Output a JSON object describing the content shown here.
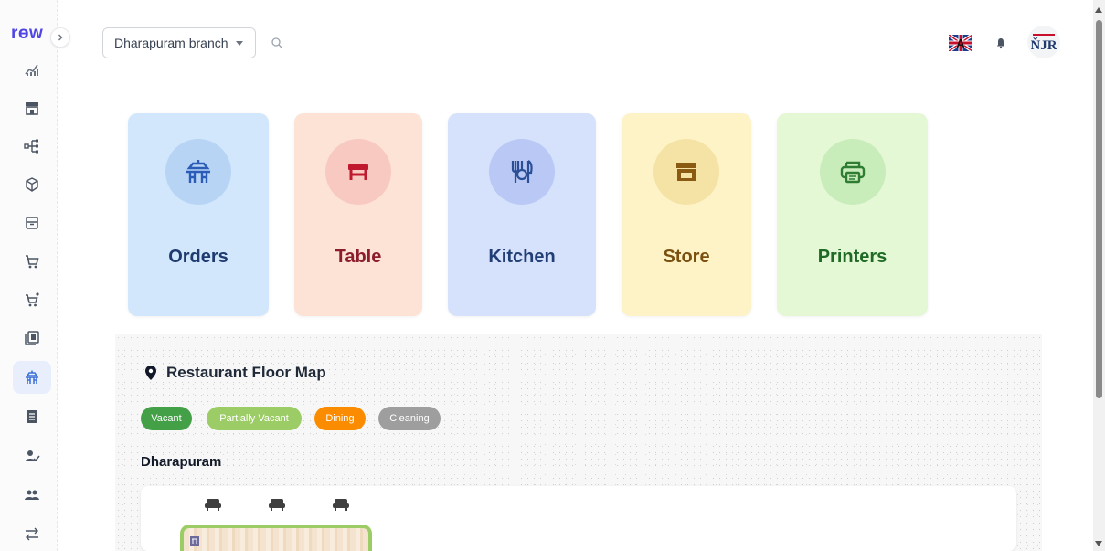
{
  "app": {
    "logo_text": "rөw"
  },
  "header": {
    "branch_selector": {
      "value": "Dharapuram branch"
    },
    "avatar_text": "ŇJR"
  },
  "sidebar": {
    "items": [
      {
        "icon": "analytics-icon",
        "active": false
      },
      {
        "icon": "store-icon",
        "active": false
      },
      {
        "icon": "hierarchy-icon",
        "active": false
      },
      {
        "icon": "cube-icon",
        "active": false
      },
      {
        "icon": "archive-box-icon",
        "active": false
      },
      {
        "icon": "cart-icon",
        "active": false
      },
      {
        "icon": "cart-plus-icon",
        "active": false
      },
      {
        "icon": "layers-icon",
        "active": false
      },
      {
        "icon": "dining-table-icon",
        "active": true
      },
      {
        "icon": "list-icon",
        "active": false
      },
      {
        "icon": "user-check-icon",
        "active": false
      },
      {
        "icon": "users-icon",
        "active": false
      },
      {
        "icon": "transfer-icon",
        "active": false
      }
    ]
  },
  "modules": [
    {
      "label": "Orders",
      "bg": "#d3e7fc",
      "circle": "#b8d4f5",
      "color": "#1e3a6e",
      "icon": "dining-table-icon"
    },
    {
      "label": "Table",
      "bg": "#fde3d6",
      "circle": "#f8c9c0",
      "color": "#8c1d2b",
      "icon": "table-icon"
    },
    {
      "label": "Kitchen",
      "bg": "#d6e2fc",
      "circle": "#b9c8f4",
      "color": "#213f74",
      "icon": "kitchen-utensils-icon"
    },
    {
      "label": "Store",
      "bg": "#fdf3c6",
      "circle": "#f5e3a6",
      "color": "#7a5010",
      "icon": "store-icon"
    },
    {
      "label": "Printers",
      "bg": "#e5f8d6",
      "circle": "#c9ecbb",
      "color": "#1f6b25",
      "icon": "printer-icon"
    }
  ],
  "floor_map": {
    "title": "Restaurant Floor Map",
    "legend": [
      {
        "label": "Vacant",
        "color": "#43a047"
      },
      {
        "label": "Partially Vacant",
        "color": "#9ccc65"
      },
      {
        "label": "Dining",
        "color": "#fb8c00"
      },
      {
        "label": "Cleaning",
        "color": "#9e9e9e"
      }
    ],
    "area_name": "Dharapuram"
  },
  "colors": {
    "accent": "#4f46e5",
    "active_nav_bg": "#e8eefb"
  }
}
